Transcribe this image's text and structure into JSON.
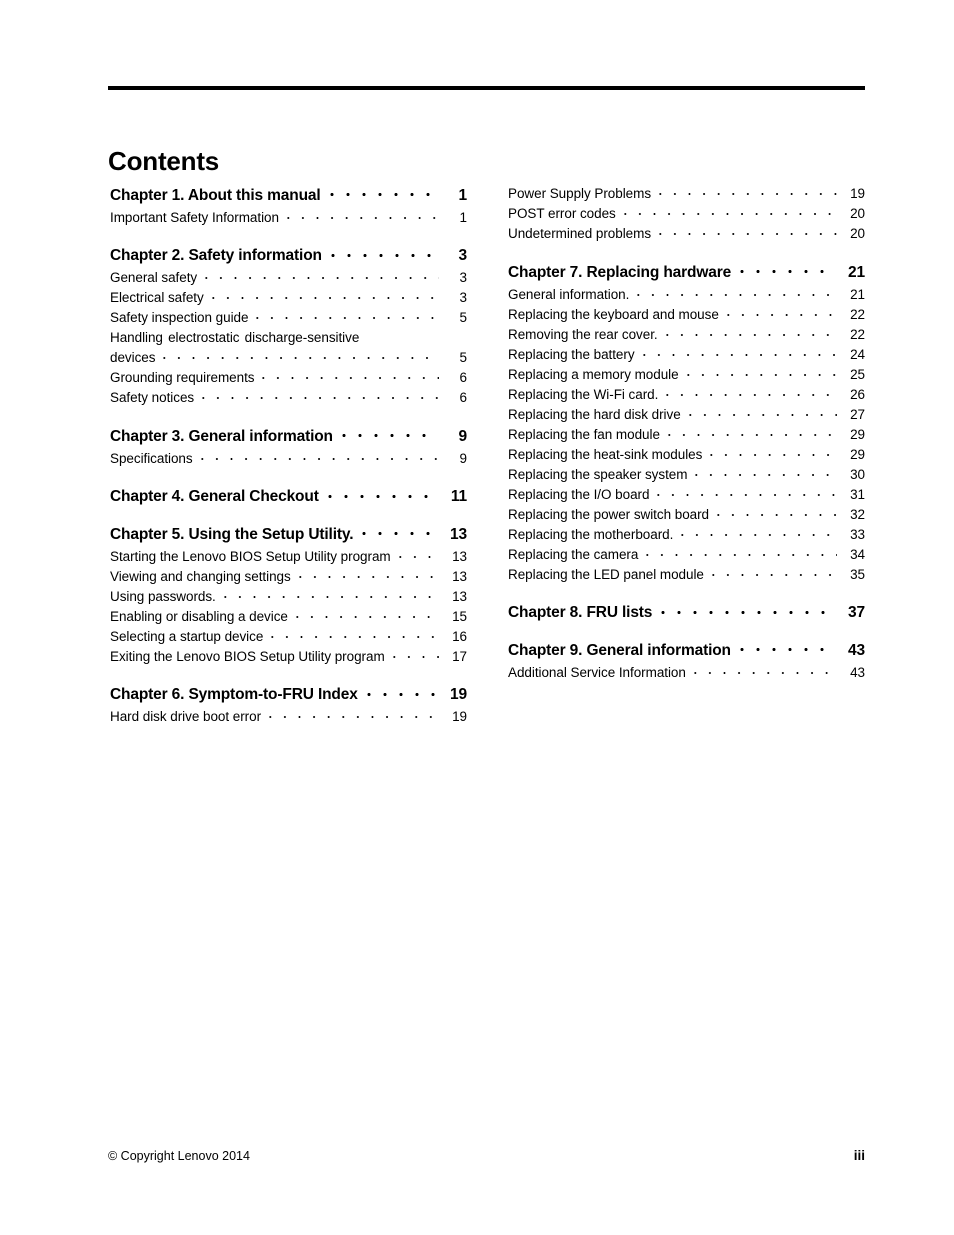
{
  "document": {
    "title": "Contents"
  },
  "toc": {
    "left_column": [
      {
        "type": "chapter",
        "label": "Chapter 1. About this manual",
        "page": "1"
      },
      {
        "type": "entry",
        "label": "Important Safety Information",
        "page": "1"
      },
      {
        "type": "chapter",
        "label": "Chapter 2. Safety information",
        "page": "3"
      },
      {
        "type": "entry",
        "label": "General safety",
        "page": "3"
      },
      {
        "type": "entry",
        "label": "Electrical safety",
        "page": "3"
      },
      {
        "type": "entry",
        "label": "Safety inspection guide",
        "page": "5"
      },
      {
        "type": "entry-wrapped",
        "label_line1": "Handling electrostatic discharge-sensitive",
        "label": "devices",
        "page": "5"
      },
      {
        "type": "entry",
        "label": "Grounding requirements",
        "page": "6"
      },
      {
        "type": "entry",
        "label": "Safety notices",
        "page": "6"
      },
      {
        "type": "chapter",
        "label": "Chapter 3. General information",
        "page": "9"
      },
      {
        "type": "entry",
        "label": "Specifications",
        "page": "9"
      },
      {
        "type": "chapter",
        "label": "Chapter 4. General Checkout",
        "page": "11"
      },
      {
        "type": "chapter",
        "label": "Chapter 5. Using the Setup Utility.",
        "page": "13"
      },
      {
        "type": "entry",
        "label": "Starting the Lenovo BIOS Setup Utility program",
        "page": "13"
      },
      {
        "type": "entry",
        "label": "Viewing and changing settings",
        "page": "13"
      },
      {
        "type": "entry",
        "label": "Using passwords.",
        "page": "13"
      },
      {
        "type": "entry",
        "label": "Enabling or disabling a device",
        "page": "15"
      },
      {
        "type": "entry",
        "label": "Selecting a startup device",
        "page": "16"
      },
      {
        "type": "entry",
        "label": "Exiting the Lenovo BIOS Setup Utility program",
        "page": "17"
      },
      {
        "type": "chapter",
        "label": "Chapter 6. Symptom-to-FRU Index",
        "page": "19"
      },
      {
        "type": "entry",
        "label": "Hard disk drive boot error",
        "page": "19"
      }
    ],
    "right_column": [
      {
        "type": "entry",
        "label": "Power Supply Problems",
        "page": "19"
      },
      {
        "type": "entry",
        "label": "POST error codes",
        "page": "20"
      },
      {
        "type": "entry",
        "label": "Undetermined problems",
        "page": "20"
      },
      {
        "type": "chapter",
        "label": "Chapter 7. Replacing hardware",
        "page": "21"
      },
      {
        "type": "entry",
        "label": "General information.",
        "page": "21"
      },
      {
        "type": "entry",
        "label": "Replacing the keyboard and mouse",
        "page": "22"
      },
      {
        "type": "entry",
        "label": "Removing the rear cover.",
        "page": "22"
      },
      {
        "type": "entry",
        "label": "Replacing the battery",
        "page": "24"
      },
      {
        "type": "entry",
        "label": "Replacing a memory module",
        "page": "25"
      },
      {
        "type": "entry",
        "label": "Replacing the Wi-Fi card.",
        "page": "26"
      },
      {
        "type": "entry",
        "label": "Replacing the hard disk drive",
        "page": "27"
      },
      {
        "type": "entry",
        "label": "Replacing the fan module",
        "page": "29"
      },
      {
        "type": "entry",
        "label": "Replacing the heat-sink modules",
        "page": "29"
      },
      {
        "type": "entry",
        "label": "Replacing the speaker system",
        "page": "30"
      },
      {
        "type": "entry",
        "label": "Replacing the I/O board",
        "page": "31"
      },
      {
        "type": "entry",
        "label": "Replacing the power switch board",
        "page": "32"
      },
      {
        "type": "entry",
        "label": "Replacing the motherboard.",
        "page": "33"
      },
      {
        "type": "entry",
        "label": "Replacing the camera",
        "page": "34"
      },
      {
        "type": "entry",
        "label": "Replacing the LED panel module",
        "page": "35"
      },
      {
        "type": "chapter",
        "label": "Chapter 8. FRU lists",
        "page": "37"
      },
      {
        "type": "chapter",
        "label": "Chapter 9. General information",
        "page": "43"
      },
      {
        "type": "entry",
        "label": "Additional Service Information",
        "page": "43"
      }
    ]
  },
  "footer": {
    "copyright": "© Copyright Lenovo 2014",
    "page_number": "iii"
  }
}
